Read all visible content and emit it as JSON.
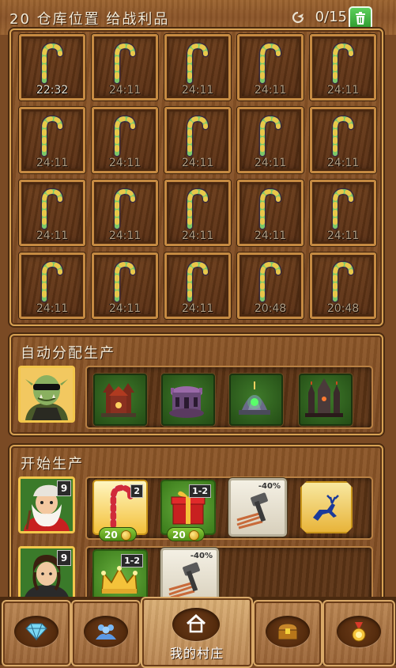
{
  "header": {
    "title": "20 仓库位置 给战利品",
    "counter": "0/15"
  },
  "warehouse": {
    "slots": [
      {
        "time": "22:32",
        "active": true
      },
      {
        "time": "24:11"
      },
      {
        "time": "24:11"
      },
      {
        "time": "24:11"
      },
      {
        "time": "24:11"
      },
      {
        "time": "24:11"
      },
      {
        "time": "24:11"
      },
      {
        "time": "24:11"
      },
      {
        "time": "24:11"
      },
      {
        "time": "24:11"
      },
      {
        "time": "24:11"
      },
      {
        "time": "24:11"
      },
      {
        "time": "24:11"
      },
      {
        "time": "24:11"
      },
      {
        "time": "24:11"
      },
      {
        "time": "24:11"
      },
      {
        "time": "24:11"
      },
      {
        "time": "24:11"
      },
      {
        "time": "20:48"
      },
      {
        "time": "20:48"
      }
    ]
  },
  "auto_assign": {
    "title": "自动分配生产"
  },
  "production": {
    "title": "开始生产",
    "rows": [
      {
        "level": "9",
        "items": [
          {
            "qty": "2",
            "cost": "20"
          },
          {
            "qty": "1-2",
            "cost": "20"
          }
        ],
        "boost_pct": "-40%"
      },
      {
        "level": "9",
        "items": [
          {
            "qty": "1-2"
          }
        ],
        "boost_pct": "-40%"
      }
    ]
  },
  "nav": {
    "village_label": "我的村庄"
  },
  "colors": {
    "wood": "#8a5428",
    "frame": "#c58a42",
    "accent_green": "#3f7a2a",
    "gold": "#f3c64a"
  }
}
